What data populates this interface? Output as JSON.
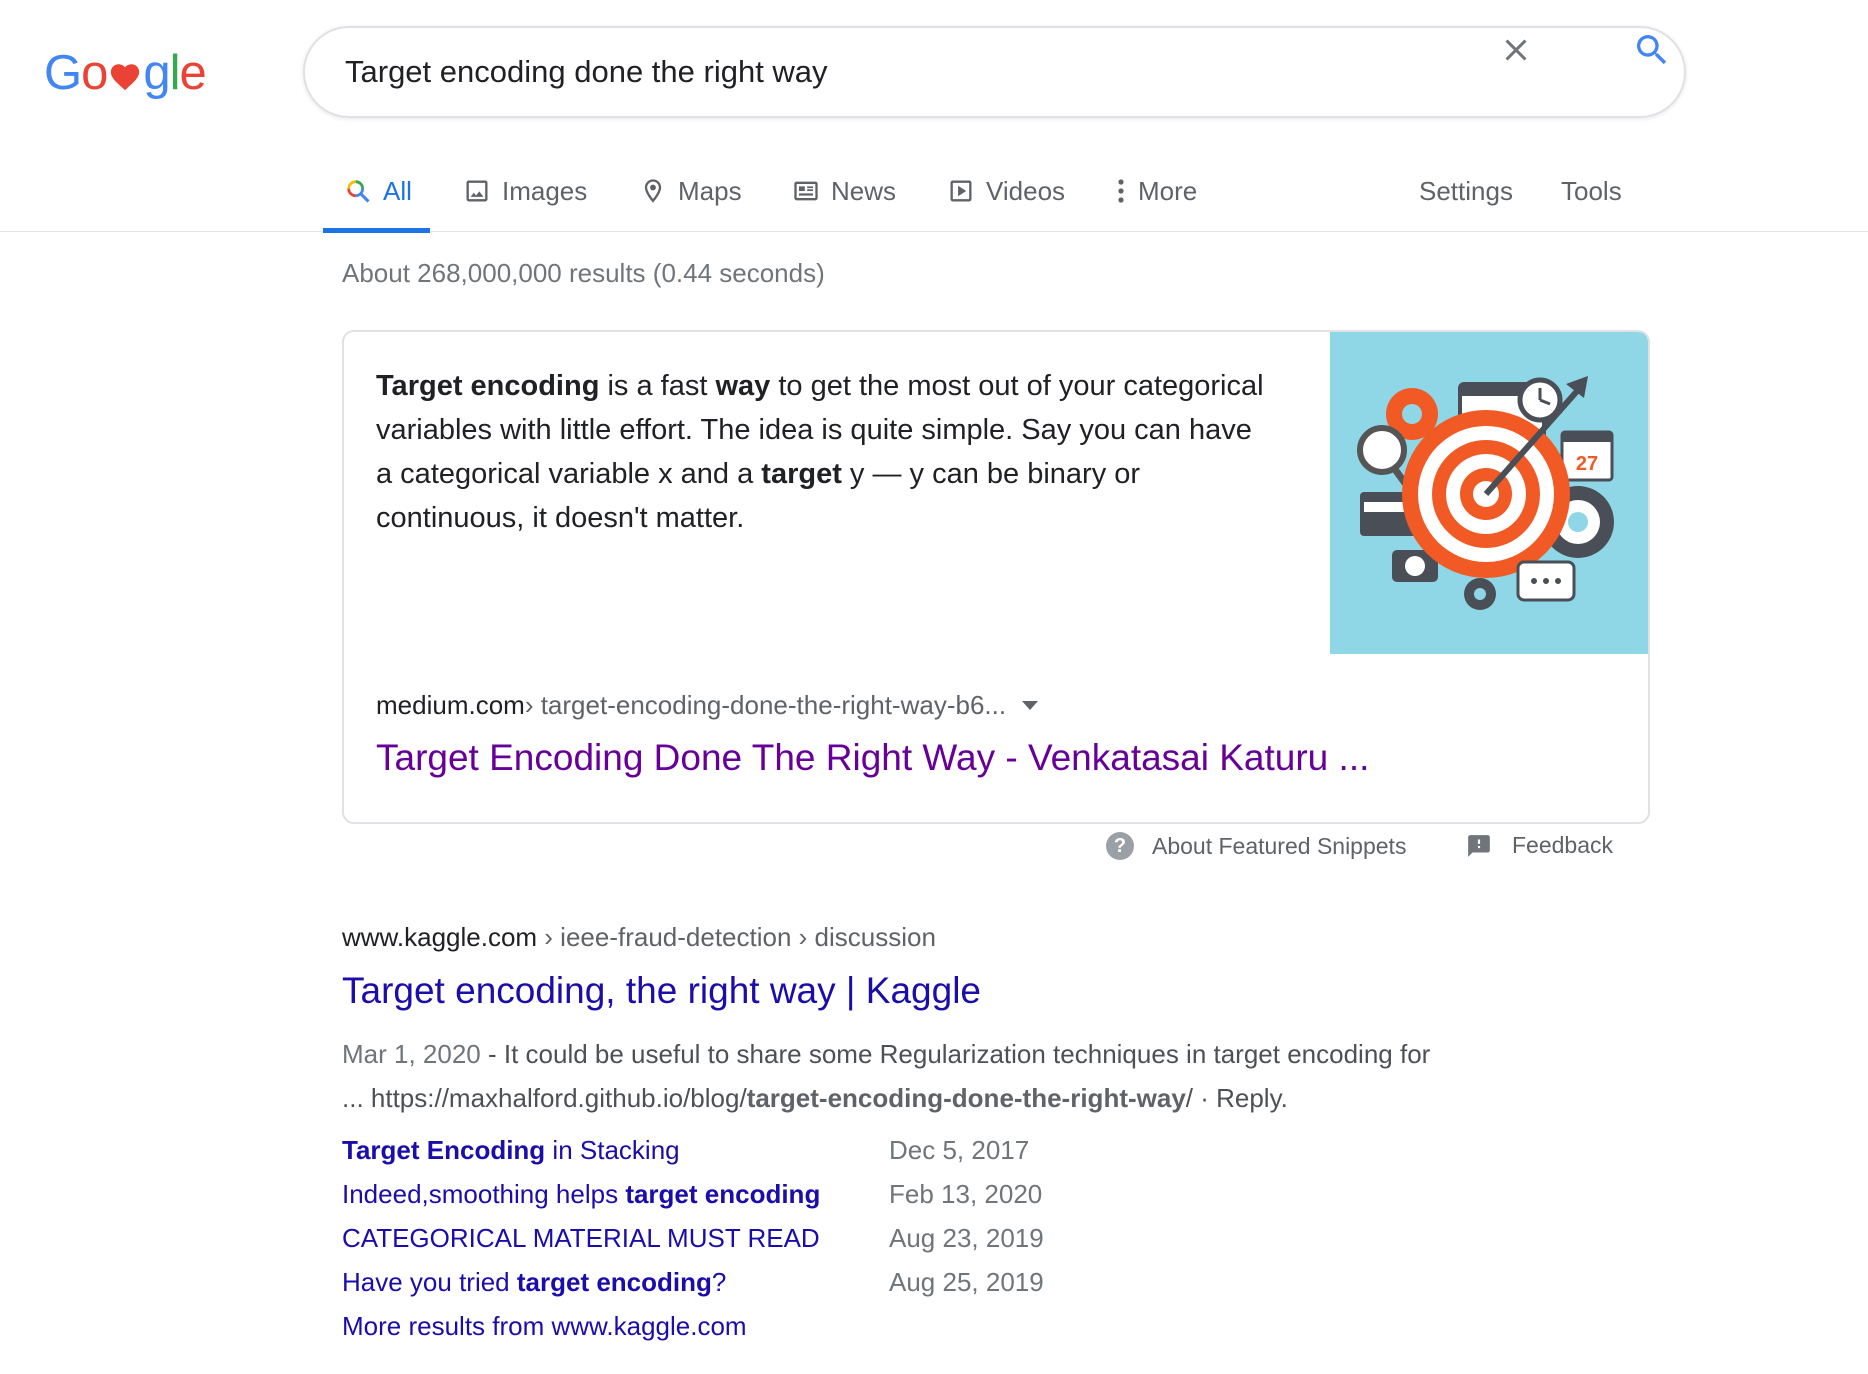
{
  "logo": {
    "letters": [
      "G",
      "o",
      "g",
      "l",
      "e"
    ],
    "heart_icon": "heart-icon"
  },
  "search": {
    "value": "Target encoding done the right way",
    "placeholder": "",
    "clear_icon": "close-icon",
    "search_icon": "search-icon"
  },
  "tabs": [
    {
      "label": "All",
      "icon": "search-icon",
      "active": true
    },
    {
      "label": "Images",
      "icon": "image-icon"
    },
    {
      "label": "Maps",
      "icon": "map-pin-icon"
    },
    {
      "label": "News",
      "icon": "newspaper-icon"
    },
    {
      "label": "Videos",
      "icon": "play-icon"
    },
    {
      "label": "More",
      "icon": "more-vertical-icon"
    },
    {
      "label": "Settings"
    },
    {
      "label": "Tools"
    }
  ],
  "result_stats": "About 268,000,000 results (0.44 seconds)",
  "snippet": {
    "text_parts": [
      {
        "text": "Target encoding",
        "bold": true
      },
      {
        "text": " is a fast ",
        "bold": false
      },
      {
        "text": "way",
        "bold": true
      },
      {
        "text": " to get the most out of your categorical variables with little effort. The idea is quite simple. Say you can have a categorical variable x and a ",
        "bold": false
      },
      {
        "text": "target",
        "bold": true
      },
      {
        "text": " y — y can be binary or continuous, it doesn't matter.",
        "bold": false
      }
    ],
    "image_calendar_number": "27",
    "cite_domain": "medium.com",
    "cite_path": " › target-encoding-done-the-right-way-b6...",
    "title": "Target Encoding Done The Right Way - Venkatasai Katuru ...",
    "about_label": "About Featured Snippets",
    "feedback_label": "Feedback",
    "colors": {
      "image_bg": "#8fd6e6",
      "target_red": "#f15a24",
      "visited_link": "#660099"
    }
  },
  "result": {
    "cite_domain": "www.kaggle.com",
    "cite_path": " › ieee-fraud-detection › discussion",
    "title": "Target encoding, the right way | Kaggle",
    "date": "Mar 1, 2020",
    "desc_line1": " - It could be useful to share some Regularization techniques in target encoding for",
    "desc_line2_pre": "... https://maxhalford.github.io/blog/",
    "desc_line2_bold": "target-encoding-done-the-right-way",
    "desc_line2_post": "/ · Reply.",
    "sitelinks": [
      {
        "parts": [
          {
            "text": "Target Encoding",
            "bold": true
          },
          {
            "text": " in Stacking",
            "bold": false
          }
        ],
        "date": "Dec 5, 2017"
      },
      {
        "parts": [
          {
            "text": "Indeed,smoothing helps ",
            "bold": false
          },
          {
            "text": "target encoding",
            "bold": true
          }
        ],
        "date": "Feb 13, 2020"
      },
      {
        "parts": [
          {
            "text": "CATEGORICAL MATERIAL MUST READ",
            "bold": false
          }
        ],
        "date": "Aug 23, 2019"
      },
      {
        "parts": [
          {
            "text": "Have you tried ",
            "bold": false
          },
          {
            "text": "target encoding",
            "bold": true
          },
          {
            "text": "?",
            "bold": false
          }
        ],
        "date": "Aug 25, 2019"
      }
    ],
    "more_results": "More results from www.kaggle.com",
    "colors": {
      "link": "#1a0dab"
    }
  }
}
